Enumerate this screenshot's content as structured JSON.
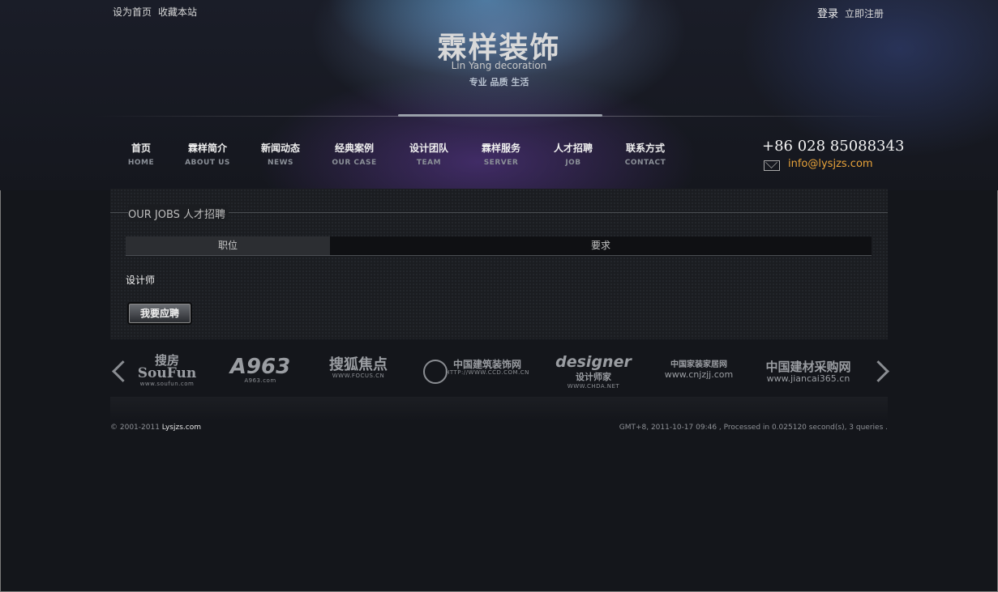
{
  "top_links": {
    "set_home": "设为首页",
    "bookmark": "收藏本站",
    "login": "登录",
    "register": "立即注册"
  },
  "brand": {
    "name_cn": "霖样装饰",
    "name_en": "Lin Yang decoration",
    "slogan": "专业 品质 生活"
  },
  "nav": [
    {
      "cn": "首页",
      "en": "HOME"
    },
    {
      "cn": "霖样简介",
      "en": "ABOUT US"
    },
    {
      "cn": "新闻动态",
      "en": "NEWS"
    },
    {
      "cn": "经典案例",
      "en": "OUR CASE"
    },
    {
      "cn": "设计团队",
      "en": "TEAM"
    },
    {
      "cn": "霖样服务",
      "en": "SERVER"
    },
    {
      "cn": "人才招聘",
      "en": "JOB"
    },
    {
      "cn": "联系方式",
      "en": "CONTACT"
    }
  ],
  "contact": {
    "phone": "+86 028 85088343",
    "email": "info@lysjzs.com"
  },
  "jobs": {
    "title": "OUR JOBS  人才招聘",
    "columns": [
      "职位",
      "要求"
    ],
    "items": [
      "设计师"
    ],
    "apply_label": "我要应聘"
  },
  "partners": [
    {
      "name": "搜房",
      "sub": "SouFun",
      "url": "www.soufun.com"
    },
    {
      "name": "A963",
      "sub": "",
      "url": "A963.com"
    },
    {
      "name": "搜狐焦点",
      "sub": "",
      "url": "WWW.FOCUS.CN"
    },
    {
      "name": "中国建筑装饰网",
      "sub": "",
      "url": "HTTP://WWW.CCD.COM.CN"
    },
    {
      "name": "designer",
      "sub": "设计师家",
      "url": "WWW.CHDA.NET"
    },
    {
      "name": "中国家装家居网",
      "sub": "",
      "url": "www.cnjzjj.com"
    },
    {
      "name": "中国建材采购网",
      "sub": "",
      "url": "www.jiancai365.cn"
    }
  ],
  "footer": {
    "copyright_prefix": "© 2001-2011",
    "site": "Lysjzs.com",
    "status": "GMT+8, 2011-10-17 09:46 , Processed in 0.025120 second(s), 3 queries ."
  }
}
